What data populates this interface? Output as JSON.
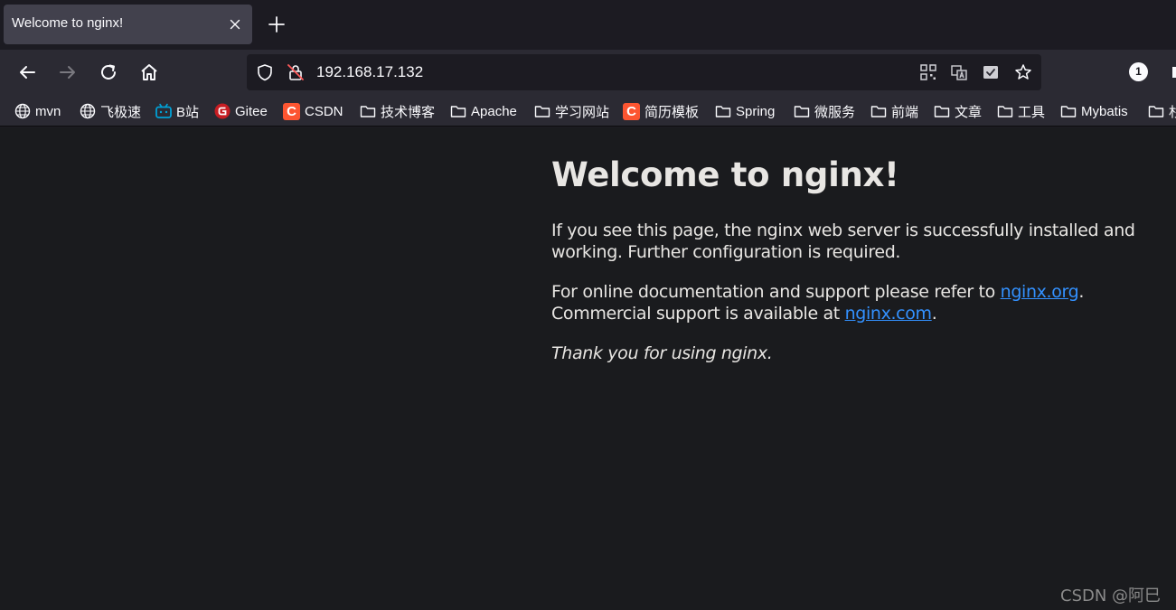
{
  "tab": {
    "title": "Welcome to nginx!"
  },
  "address_bar": {
    "url": "192.168.17.132"
  },
  "extensions": {
    "badge_count": "1"
  },
  "bookmarks": [
    {
      "label": "mvn",
      "icon": "globe-icon"
    },
    {
      "label": "飞极速",
      "icon": "globe-icon"
    },
    {
      "label": "B站",
      "icon": "bilibili-icon"
    },
    {
      "label": "Gitee",
      "icon": "gitee-icon"
    },
    {
      "label": "CSDN",
      "icon": "csdn-icon",
      "glyph": "C"
    },
    {
      "label": "技术博客",
      "icon": "folder-icon"
    },
    {
      "label": "Apache",
      "icon": "folder-icon"
    },
    {
      "label": "学习网站",
      "icon": "folder-icon"
    },
    {
      "label": "简历模板",
      "icon": "csdn-icon",
      "glyph": "C"
    },
    {
      "label": "Spring",
      "icon": "folder-icon"
    },
    {
      "label": "微服务",
      "icon": "folder-icon"
    },
    {
      "label": "前端",
      "icon": "folder-icon"
    },
    {
      "label": "文章",
      "icon": "folder-icon"
    },
    {
      "label": "工具",
      "icon": "folder-icon"
    },
    {
      "label": "Mybatis",
      "icon": "folder-icon"
    },
    {
      "label": "杉",
      "icon": "folder-icon"
    }
  ],
  "page": {
    "heading": "Welcome to nginx!",
    "p1_line1": "If you see this page, the nginx web server is successfully installed and",
    "p1_line2": "working. Further configuration is required.",
    "p2_line1_prefix": "For online documentation and support please refer to ",
    "p2_link1": "nginx.org",
    "p2_line1_suffix": ".",
    "p2_line2_prefix": "Commercial support is available at ",
    "p2_link2": "nginx.com",
    "p2_line2_suffix": ".",
    "thanks": "Thank you for using nginx."
  },
  "watermark": "CSDN @阿巳",
  "colors": {
    "tab_bg": "#42414d",
    "toolbar_bg": "#2b2a33",
    "page_bg": "#1a1b1e",
    "link": "#3391ff",
    "csdn_brand": "#fc5531",
    "gitee_brand": "#c71d23",
    "bilibili_brand": "#00a1d6"
  }
}
